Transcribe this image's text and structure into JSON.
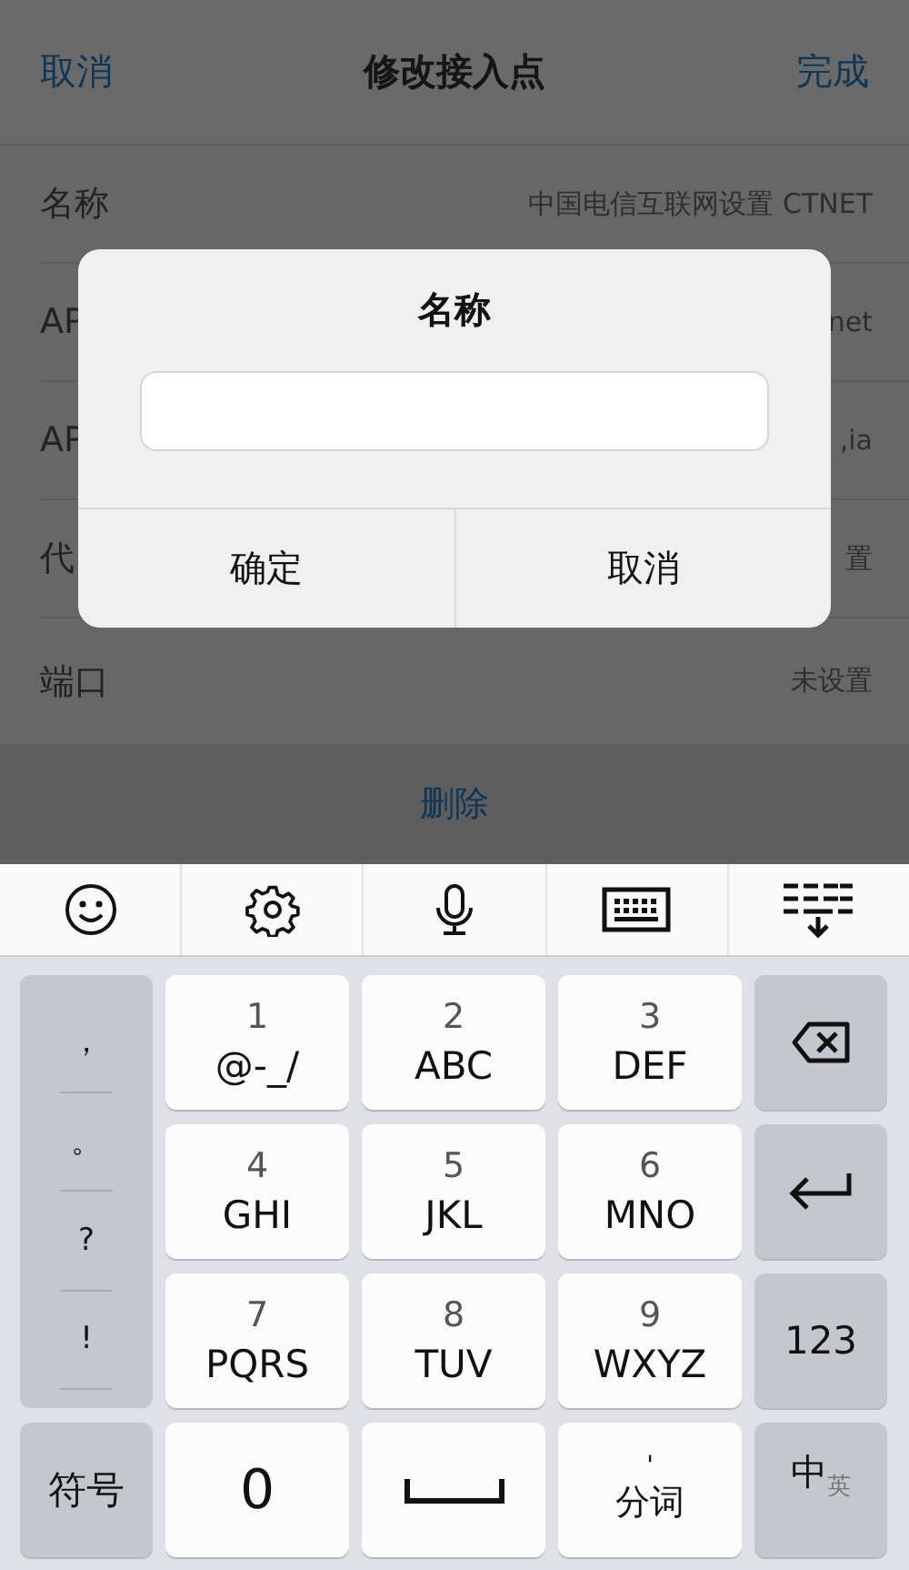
{
  "nav_bar": {
    "cancel": "取消",
    "title": "修改接入点",
    "done": "完成"
  },
  "rows": [
    {
      "label": "名称",
      "value": "中国电信互联网设置 CTNET"
    },
    {
      "label": "AP",
      "value": "net"
    },
    {
      "label": "AP",
      "value": ",ia"
    },
    {
      "label": "代",
      "value": "置"
    },
    {
      "label": "端口",
      "value": "未设置"
    }
  ],
  "delete": "删除",
  "dialog": {
    "title": "名称",
    "buttons": [
      "确定",
      "取消"
    ]
  },
  "keyboard": {
    "punctuation": [
      "，",
      "。",
      "?",
      "!"
    ],
    "keys": [
      {
        "kind": "digit",
        "digit": "1",
        "letters": "@-_/"
      },
      {
        "kind": "digit",
        "digit": "2",
        "letters": "ABC"
      },
      {
        "kind": "digit",
        "digit": "3",
        "letters": "DEF"
      },
      {
        "kind": "backspace"
      },
      {
        "kind": "digit",
        "digit": "4",
        "letters": "GHI"
      },
      {
        "kind": "digit",
        "digit": "5",
        "letters": "JKL"
      },
      {
        "kind": "digit",
        "digit": "6",
        "letters": "MNO"
      },
      {
        "kind": "enter"
      },
      {
        "kind": "digit",
        "digit": "7",
        "letters": "PQRS"
      },
      {
        "kind": "digit",
        "digit": "8",
        "letters": "TUV"
      },
      {
        "kind": "digit",
        "digit": "9",
        "letters": "WXYZ"
      },
      {
        "kind": "mode",
        "label": "123"
      },
      {
        "kind": "mode",
        "label": "符号"
      },
      {
        "kind": "single",
        "label": "0"
      },
      {
        "kind": "space"
      },
      {
        "kind": "segment",
        "mark": "'",
        "label": "分词"
      },
      {
        "kind": "lang",
        "label": "中",
        "alt": "英"
      }
    ]
  }
}
